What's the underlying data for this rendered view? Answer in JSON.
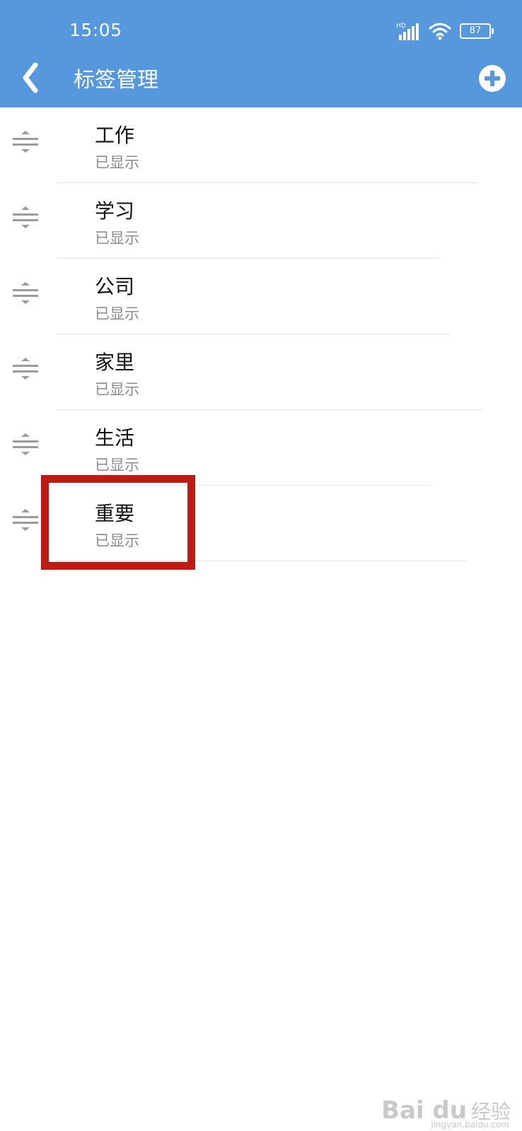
{
  "status_bar": {
    "time": "15:05",
    "battery": "87"
  },
  "header": {
    "title": "标签管理"
  },
  "tags": [
    {
      "name": "工作",
      "status": "已显示"
    },
    {
      "name": "学习",
      "status": "已显示"
    },
    {
      "name": "公司",
      "status": "已显示"
    },
    {
      "name": "家里",
      "status": "已显示"
    },
    {
      "name": "生活",
      "status": "已显示"
    },
    {
      "name": "重要",
      "status": "已显示"
    }
  ],
  "watermark": {
    "logo": "Bai du",
    "text": "经验",
    "url": "jingyan.baidu.com"
  },
  "colors": {
    "header_bg": "#5598de",
    "highlight_border": "#be1b14"
  }
}
